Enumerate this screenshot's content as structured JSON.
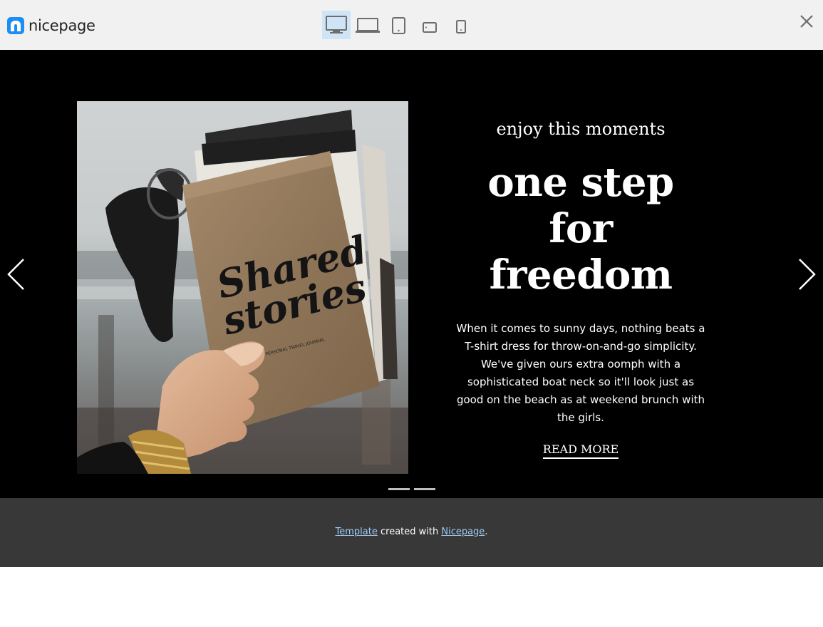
{
  "brand": {
    "name": "nicepage",
    "color": "#1e8ef2"
  },
  "toolbar": {
    "devices": [
      {
        "name": "desktop-icon",
        "active": true
      },
      {
        "name": "laptop-icon",
        "active": false
      },
      {
        "name": "tablet-icon",
        "active": false
      },
      {
        "name": "tablet-landscape-icon",
        "active": false
      },
      {
        "name": "phone-icon",
        "active": false
      }
    ],
    "close_icon": "close-icon"
  },
  "slide": {
    "subtitle": "enjoy this moments",
    "headline_lines": [
      "one step",
      "for",
      "freedom"
    ],
    "description": "When it comes to sunny days, nothing beats a T-shirt dress for throw-on-and-go simplicity. We've given ours extra oomph with a sophisticated boat neck so it'll look just as good on the beach as at weekend brunch with the girls.",
    "read_more": "READ MORE",
    "image": {
      "book_title_lines": [
        "Shared",
        "stories"
      ],
      "book_caption": "PERSONAL TRAVEL JOURNAL"
    },
    "prev_icon": "chevron-left-icon",
    "next_icon": "chevron-right-icon",
    "indicator_count": 2
  },
  "footer": {
    "link1": "Template",
    "middle": " created with ",
    "link2": "Nicepage",
    "end": "."
  }
}
